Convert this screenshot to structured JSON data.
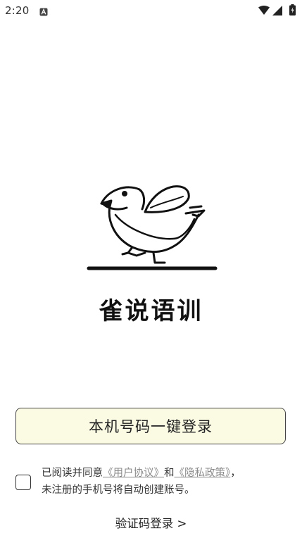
{
  "status_bar": {
    "time": "2:20",
    "icons": [
      "a-notification-icon",
      "wifi-icon",
      "signal-icon",
      "battery-icon"
    ]
  },
  "app": {
    "title": "雀说语训",
    "logo_icon": "sparrow-logo-icon"
  },
  "login": {
    "one_click_label": "本机号码一键登录",
    "one_click_bg": "#fbfbe4"
  },
  "agreement": {
    "checked": false,
    "prefix": "已阅读并同意",
    "user_agreement": "《用户协议》",
    "and": "和",
    "privacy_policy": "《隐私政策》",
    "suffix": "，",
    "line2": "未注册的手机号将自动创建账号。"
  },
  "alt_login": {
    "label": "验证码登录 >"
  }
}
